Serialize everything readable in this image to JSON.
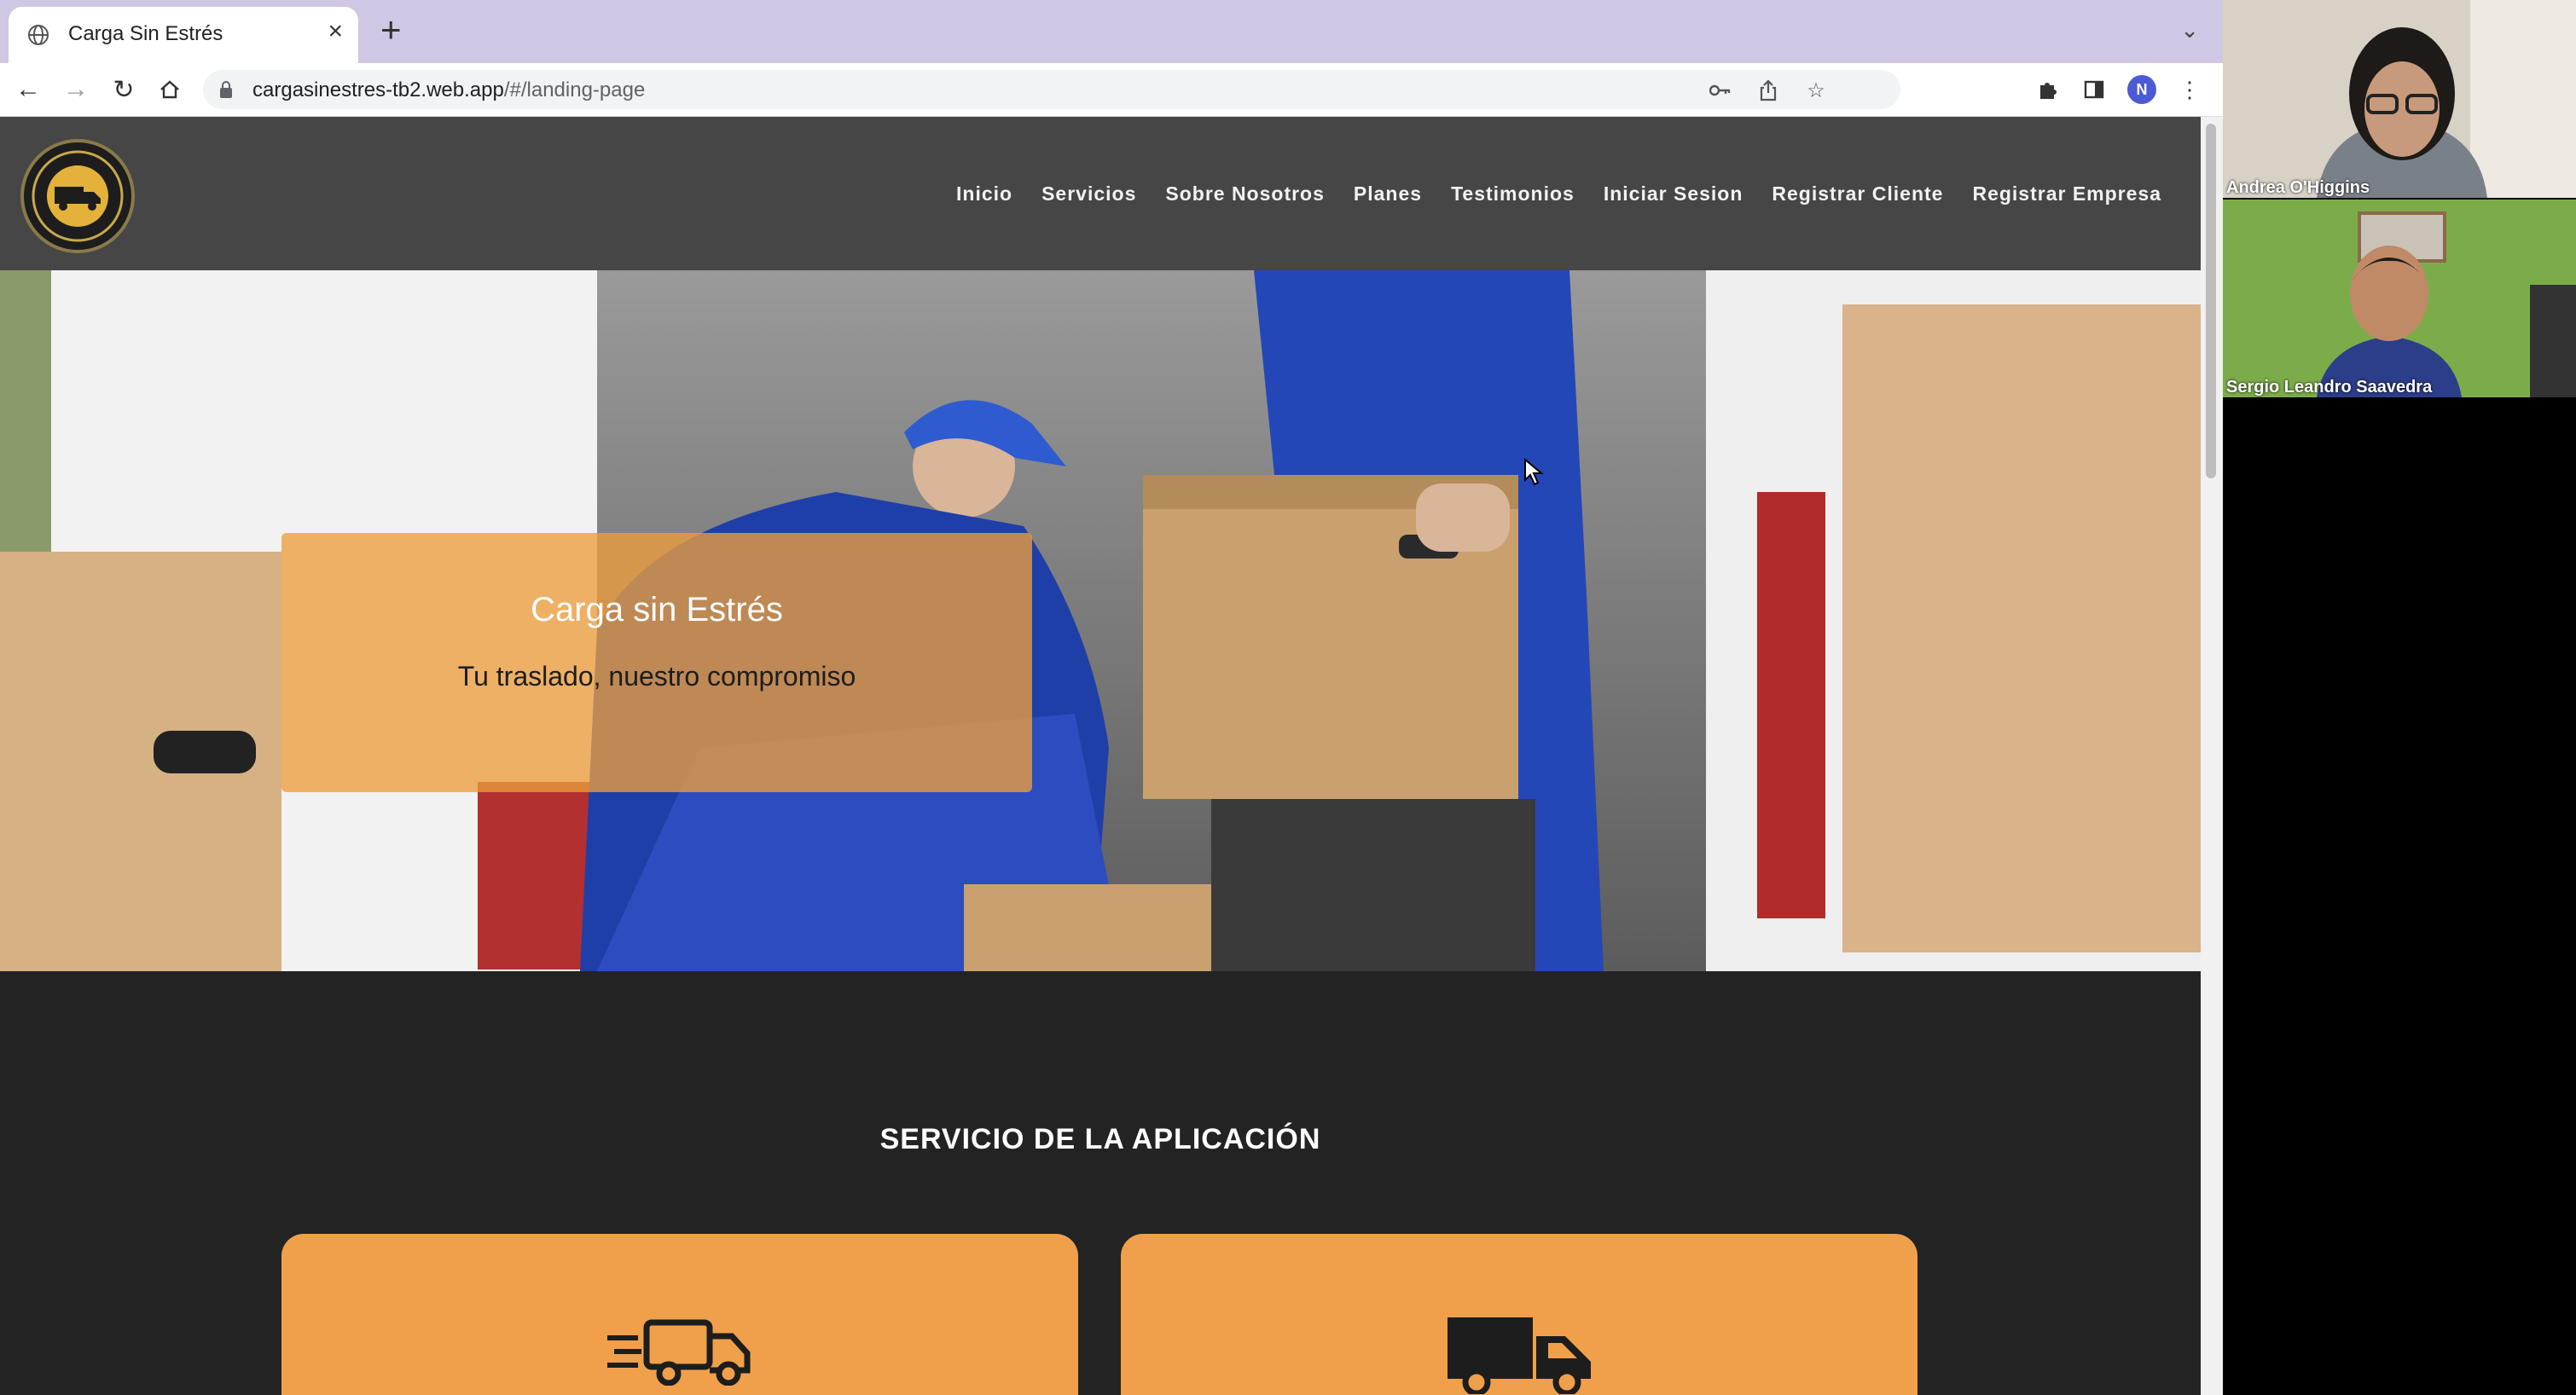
{
  "browser": {
    "tab": {
      "title": "Carga Sin Estrés",
      "close_glyph": "×"
    },
    "new_tab_glyph": "+",
    "url": {
      "host": "cargasinestres-tb2.web.app",
      "path": "/#/landing-page"
    },
    "profile_initial": "N"
  },
  "site": {
    "nav": [
      "Inicio",
      "Servicios",
      "Sobre Nosotros",
      "Planes",
      "Testimonios",
      "Iniciar Sesion",
      "Registrar Cliente",
      "Registrar Empresa"
    ],
    "hero": {
      "title": "Carga sin Estrés",
      "subtitle": "Tu traslado, nuestro compromiso"
    },
    "section_title": "SERVICIO DE LA APLICACIÓN"
  },
  "call": {
    "participants": [
      {
        "name": "Andrea O'Higgins"
      },
      {
        "name": "Sergio Leandro Saavedra"
      }
    ]
  },
  "colors": {
    "accent_orange": "#f0a04b",
    "nav_bg": "#464646",
    "page_bg": "#232323",
    "tabstrip": "#cfc7e3"
  },
  "icons": [
    "globe-icon",
    "close-icon",
    "plus-icon",
    "chevron-down-icon",
    "back-icon",
    "forward-icon",
    "reload-icon",
    "home-icon",
    "lock-icon",
    "key-icon",
    "share-icon",
    "star-icon",
    "puzzle-icon",
    "sidepanel-icon",
    "kebab-menu-icon",
    "fast-truck-icon",
    "truck-icon",
    "cursor-icon"
  ]
}
